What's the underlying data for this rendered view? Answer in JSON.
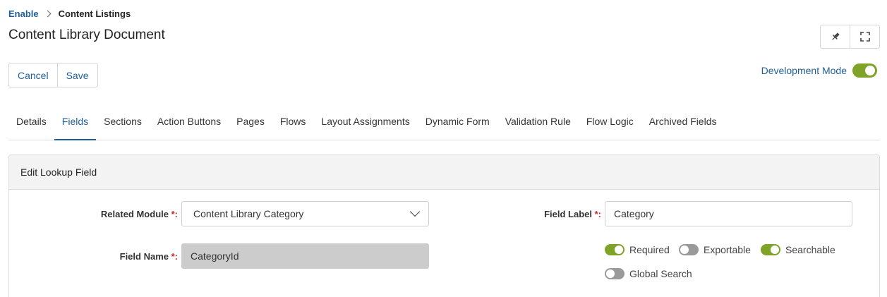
{
  "breadcrumb": {
    "root": "Enable",
    "current": "Content Listings"
  },
  "page": {
    "title": "Content Library Document"
  },
  "actions": {
    "cancel": "Cancel",
    "save": "Save"
  },
  "dev_mode": {
    "label": "Development Mode",
    "enabled": true
  },
  "tabs": [
    {
      "label": "Details",
      "active": false
    },
    {
      "label": "Fields",
      "active": true
    },
    {
      "label": "Sections",
      "active": false
    },
    {
      "label": "Action Buttons",
      "active": false
    },
    {
      "label": "Pages",
      "active": false
    },
    {
      "label": "Flows",
      "active": false
    },
    {
      "label": "Layout Assignments",
      "active": false
    },
    {
      "label": "Dynamic Form",
      "active": false
    },
    {
      "label": "Validation Rule",
      "active": false
    },
    {
      "label": "Flow Logic",
      "active": false
    },
    {
      "label": "Archived Fields",
      "active": false
    }
  ],
  "panel": {
    "title": "Edit Lookup Field"
  },
  "form": {
    "related_module": {
      "label": "Related Module",
      "required_mark": "*:",
      "value": "Content Library Category"
    },
    "field_name": {
      "label": "Field Name",
      "required_mark": "*:",
      "value": "CategoryId"
    },
    "field_label": {
      "label": "Field Label",
      "required_mark": "*:",
      "value": "Category"
    },
    "options": [
      {
        "label": "Required",
        "on": true
      },
      {
        "label": "Exportable",
        "on": false
      },
      {
        "label": "Searchable",
        "on": true
      },
      {
        "label": "Global Search",
        "on": false
      }
    ]
  },
  "icons": {
    "pin": "pin-icon",
    "fullscreen": "fullscreen-icon",
    "chevron": "chevron-down-icon"
  },
  "colors": {
    "link": "#1f5f99",
    "toggle_on": "#7ea327",
    "toggle_off": "#9a9a9a",
    "required": "#c62828"
  }
}
